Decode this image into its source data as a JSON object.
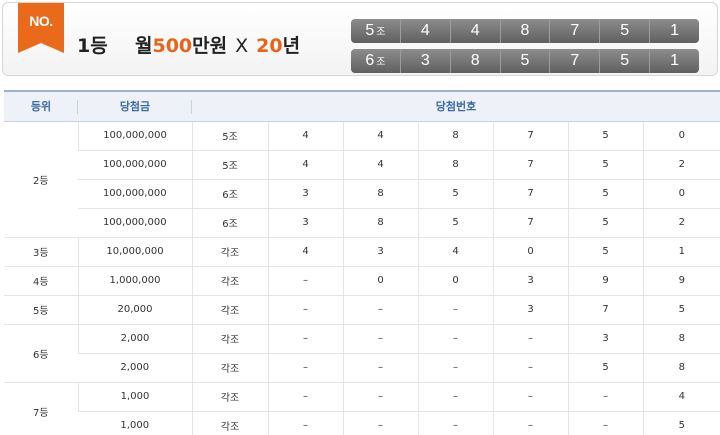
{
  "header": {
    "badge": "NO.",
    "rank": "1등",
    "prize_prefix": "월",
    "prize_amount": "500",
    "prize_unit": "만원",
    "multiplier": "X",
    "years_num": "20",
    "years_unit": "년"
  },
  "winning_rows": [
    {
      "group": "5",
      "group_unit": "조",
      "numbers": [
        "4",
        "4",
        "8",
        "7",
        "5",
        "1"
      ]
    },
    {
      "group": "6",
      "group_unit": "조",
      "numbers": [
        "3",
        "8",
        "5",
        "7",
        "5",
        "1"
      ]
    }
  ],
  "table": {
    "headers": {
      "rank": "등위",
      "amount": "당첨금",
      "numbers": "당첨번호"
    },
    "groups": [
      {
        "rank": "2등",
        "rows": [
          [
            "100,000,000",
            "5조",
            "4",
            "4",
            "8",
            "7",
            "5",
            "0"
          ],
          [
            "100,000,000",
            "5조",
            "4",
            "4",
            "8",
            "7",
            "5",
            "2"
          ],
          [
            "100,000,000",
            "6조",
            "3",
            "8",
            "5",
            "7",
            "5",
            "0"
          ],
          [
            "100,000,000",
            "6조",
            "3",
            "8",
            "5",
            "7",
            "5",
            "2"
          ]
        ]
      },
      {
        "rank": "3등",
        "rows": [
          [
            "10,000,000",
            "각조",
            "4",
            "3",
            "4",
            "0",
            "5",
            "1"
          ]
        ]
      },
      {
        "rank": "4등",
        "rows": [
          [
            "1,000,000",
            "각조",
            "–",
            "0",
            "0",
            "3",
            "9",
            "9"
          ]
        ]
      },
      {
        "rank": "5등",
        "rows": [
          [
            "20,000",
            "각조",
            "–",
            "–",
            "–",
            "3",
            "7",
            "5"
          ]
        ]
      },
      {
        "rank": "6등",
        "rows": [
          [
            "2,000",
            "각조",
            "–",
            "–",
            "–",
            "–",
            "3",
            "8"
          ],
          [
            "2,000",
            "각조",
            "–",
            "–",
            "–",
            "–",
            "5",
            "8"
          ]
        ]
      },
      {
        "rank": "7등",
        "rows": [
          [
            "1,000",
            "각조",
            "–",
            "–",
            "–",
            "–",
            "–",
            "4"
          ],
          [
            "1,000",
            "각조",
            "–",
            "–",
            "–",
            "–",
            "–",
            "5"
          ]
        ]
      }
    ]
  }
}
